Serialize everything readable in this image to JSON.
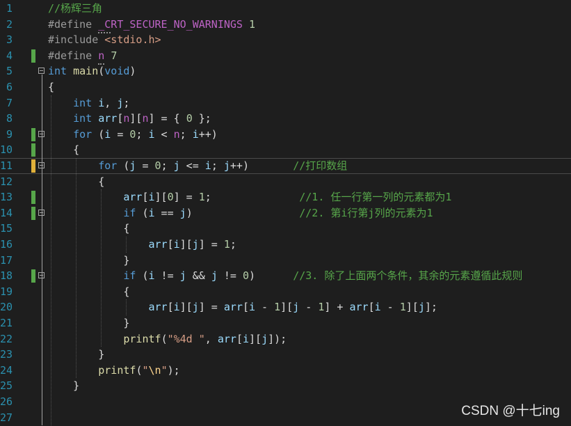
{
  "editor": {
    "colors": {
      "background": "#1e1e1e",
      "line_number": "#2b91af",
      "keyword": "#569cd6",
      "function": "#dcdcaa",
      "variable": "#9cdcfe",
      "number": "#b5cea8",
      "string": "#d69d85",
      "comment": "#57a64a",
      "macro": "#bd63c5",
      "preprocessor": "#9b9b9b",
      "change_saved": "#57a64a",
      "change_unsaved": "#e0b03a"
    },
    "current_line": 11,
    "lines": [
      {
        "n": "1",
        "change": "",
        "fold": "",
        "tokens": [
          [
            "cmt",
            "//杨辉三角"
          ]
        ]
      },
      {
        "n": "2",
        "change": "",
        "fold": "",
        "tokens": [
          [
            "pp",
            "#define "
          ],
          [
            "mac",
            "_CRT_SECURE_NO_WARNINGS"
          ],
          [
            "pun",
            " "
          ],
          [
            "num",
            "1"
          ]
        ]
      },
      {
        "n": "3",
        "change": "",
        "fold": "",
        "tokens": [
          [
            "pp",
            "#include "
          ],
          [
            "str",
            "<stdio.h>"
          ]
        ]
      },
      {
        "n": "4",
        "change": "green",
        "fold": "",
        "tokens": [
          [
            "pp",
            "#define "
          ],
          [
            "mac",
            "n"
          ],
          [
            "pun",
            " "
          ],
          [
            "num",
            "7"
          ]
        ]
      },
      {
        "n": "5",
        "change": "",
        "fold": "start",
        "tokens": [
          [
            "kw",
            "int"
          ],
          [
            "pun",
            " "
          ],
          [
            "fn",
            "main"
          ],
          [
            "pun",
            "("
          ],
          [
            "kw",
            "void"
          ],
          [
            "pun",
            ")"
          ]
        ]
      },
      {
        "n": "6",
        "change": "",
        "fold": "",
        "tokens": [
          [
            "pun",
            "{"
          ]
        ]
      },
      {
        "n": "7",
        "change": "",
        "fold": "",
        "tokens": [
          [
            "pun",
            "    "
          ],
          [
            "kw",
            "int"
          ],
          [
            "pun",
            " "
          ],
          [
            "var",
            "i"
          ],
          [
            "pun",
            ", "
          ],
          [
            "var",
            "j"
          ],
          [
            "pun",
            ";"
          ]
        ]
      },
      {
        "n": "8",
        "change": "",
        "fold": "",
        "tokens": [
          [
            "pun",
            "    "
          ],
          [
            "kw",
            "int"
          ],
          [
            "pun",
            " "
          ],
          [
            "var",
            "arr"
          ],
          [
            "pun",
            "["
          ],
          [
            "mac",
            "n"
          ],
          [
            "pun",
            "]["
          ],
          [
            "mac",
            "n"
          ],
          [
            "pun",
            "] = { "
          ],
          [
            "num",
            "0"
          ],
          [
            "pun",
            " };"
          ]
        ]
      },
      {
        "n": "9",
        "change": "green",
        "fold": "start",
        "tokens": [
          [
            "pun",
            "    "
          ],
          [
            "kw",
            "for"
          ],
          [
            "pun",
            " ("
          ],
          [
            "var",
            "i"
          ],
          [
            "pun",
            " = "
          ],
          [
            "num",
            "0"
          ],
          [
            "pun",
            "; "
          ],
          [
            "var",
            "i"
          ],
          [
            "pun",
            " < "
          ],
          [
            "mac",
            "n"
          ],
          [
            "pun",
            "; "
          ],
          [
            "var",
            "i"
          ],
          [
            "pun",
            "++)"
          ]
        ]
      },
      {
        "n": "10",
        "change": "green",
        "fold": "",
        "tokens": [
          [
            "pun",
            "    {"
          ]
        ]
      },
      {
        "n": "11",
        "change": "yellow",
        "fold": "start",
        "tokens": [
          [
            "pun",
            "        "
          ],
          [
            "kw",
            "for"
          ],
          [
            "pun",
            " ("
          ],
          [
            "var",
            "j"
          ],
          [
            "pun",
            " = "
          ],
          [
            "num",
            "0"
          ],
          [
            "pun",
            "; "
          ],
          [
            "var",
            "j"
          ],
          [
            "pun",
            " <= "
          ],
          [
            "var",
            "i"
          ],
          [
            "pun",
            "; "
          ],
          [
            "var",
            "j"
          ],
          [
            "pun",
            "++)       "
          ],
          [
            "cmt",
            "//打印数组"
          ]
        ]
      },
      {
        "n": "12",
        "change": "",
        "fold": "",
        "tokens": [
          [
            "pun",
            "        {"
          ]
        ]
      },
      {
        "n": "13",
        "change": "green",
        "fold": "",
        "tokens": [
          [
            "pun",
            "            "
          ],
          [
            "var",
            "arr"
          ],
          [
            "pun",
            "["
          ],
          [
            "var",
            "i"
          ],
          [
            "pun",
            "]["
          ],
          [
            "num",
            "0"
          ],
          [
            "pun",
            "] = "
          ],
          [
            "num",
            "1"
          ],
          [
            "pun",
            ";              "
          ],
          [
            "cmt",
            "//1. 任一行第一列的元素都为1"
          ]
        ]
      },
      {
        "n": "14",
        "change": "green",
        "fold": "start",
        "tokens": [
          [
            "pun",
            "            "
          ],
          [
            "kw",
            "if"
          ],
          [
            "pun",
            " ("
          ],
          [
            "var",
            "i"
          ],
          [
            "pun",
            " == "
          ],
          [
            "var",
            "j"
          ],
          [
            "pun",
            ")                 "
          ],
          [
            "cmt",
            "//2. 第i行第j列的元素为1"
          ]
        ]
      },
      {
        "n": "15",
        "change": "",
        "fold": "",
        "tokens": [
          [
            "pun",
            "            {"
          ]
        ]
      },
      {
        "n": "16",
        "change": "",
        "fold": "",
        "tokens": [
          [
            "pun",
            "                "
          ],
          [
            "var",
            "arr"
          ],
          [
            "pun",
            "["
          ],
          [
            "var",
            "i"
          ],
          [
            "pun",
            "]["
          ],
          [
            "var",
            "j"
          ],
          [
            "pun",
            "] = "
          ],
          [
            "num",
            "1"
          ],
          [
            "pun",
            ";"
          ]
        ]
      },
      {
        "n": "17",
        "change": "",
        "fold": "",
        "tokens": [
          [
            "pun",
            "            }"
          ]
        ]
      },
      {
        "n": "18",
        "change": "green",
        "fold": "start",
        "tokens": [
          [
            "pun",
            "            "
          ],
          [
            "kw",
            "if"
          ],
          [
            "pun",
            " ("
          ],
          [
            "var",
            "i"
          ],
          [
            "pun",
            " != "
          ],
          [
            "var",
            "j"
          ],
          [
            "pun",
            " && "
          ],
          [
            "var",
            "j"
          ],
          [
            "pun",
            " != "
          ],
          [
            "num",
            "0"
          ],
          [
            "pun",
            ")      "
          ],
          [
            "cmt",
            "//3. 除了上面两个条件，其余的元素遵循此规则"
          ]
        ]
      },
      {
        "n": "19",
        "change": "",
        "fold": "",
        "tokens": [
          [
            "pun",
            "            {"
          ]
        ]
      },
      {
        "n": "20",
        "change": "",
        "fold": "",
        "tokens": [
          [
            "pun",
            "                "
          ],
          [
            "var",
            "arr"
          ],
          [
            "pun",
            "["
          ],
          [
            "var",
            "i"
          ],
          [
            "pun",
            "]["
          ],
          [
            "var",
            "j"
          ],
          [
            "pun",
            "] = "
          ],
          [
            "var",
            "arr"
          ],
          [
            "pun",
            "["
          ],
          [
            "var",
            "i"
          ],
          [
            "pun",
            " - "
          ],
          [
            "num",
            "1"
          ],
          [
            "pun",
            "]["
          ],
          [
            "var",
            "j"
          ],
          [
            "pun",
            " - "
          ],
          [
            "num",
            "1"
          ],
          [
            "pun",
            "] + "
          ],
          [
            "var",
            "arr"
          ],
          [
            "pun",
            "["
          ],
          [
            "var",
            "i"
          ],
          [
            "pun",
            " - "
          ],
          [
            "num",
            "1"
          ],
          [
            "pun",
            "]["
          ],
          [
            "var",
            "j"
          ],
          [
            "pun",
            "];"
          ]
        ]
      },
      {
        "n": "21",
        "change": "",
        "fold": "",
        "tokens": [
          [
            "pun",
            "            }"
          ]
        ]
      },
      {
        "n": "22",
        "change": "",
        "fold": "",
        "tokens": [
          [
            "pun",
            "            "
          ],
          [
            "fn",
            "printf"
          ],
          [
            "pun",
            "("
          ],
          [
            "str",
            "\"%4d \""
          ],
          [
            "pun",
            ", "
          ],
          [
            "var",
            "arr"
          ],
          [
            "pun",
            "["
          ],
          [
            "var",
            "i"
          ],
          [
            "pun",
            "]["
          ],
          [
            "var",
            "j"
          ],
          [
            "pun",
            "]);"
          ]
        ]
      },
      {
        "n": "23",
        "change": "",
        "fold": "",
        "tokens": [
          [
            "pun",
            "        }"
          ]
        ]
      },
      {
        "n": "24",
        "change": "",
        "fold": "",
        "tokens": [
          [
            "pun",
            "        "
          ],
          [
            "fn",
            "printf"
          ],
          [
            "pun",
            "("
          ],
          [
            "str",
            "\""
          ],
          [
            "esc",
            "\\n"
          ],
          [
            "str",
            "\""
          ],
          [
            "pun",
            ");"
          ]
        ]
      },
      {
        "n": "25",
        "change": "",
        "fold": "",
        "tokens": [
          [
            "pun",
            "    }"
          ]
        ]
      },
      {
        "n": "26",
        "change": "",
        "fold": "",
        "tokens": []
      },
      {
        "n": "27",
        "change": "",
        "fold": "",
        "tokens": []
      }
    ]
  },
  "watermark": "CSDN @十七ing"
}
